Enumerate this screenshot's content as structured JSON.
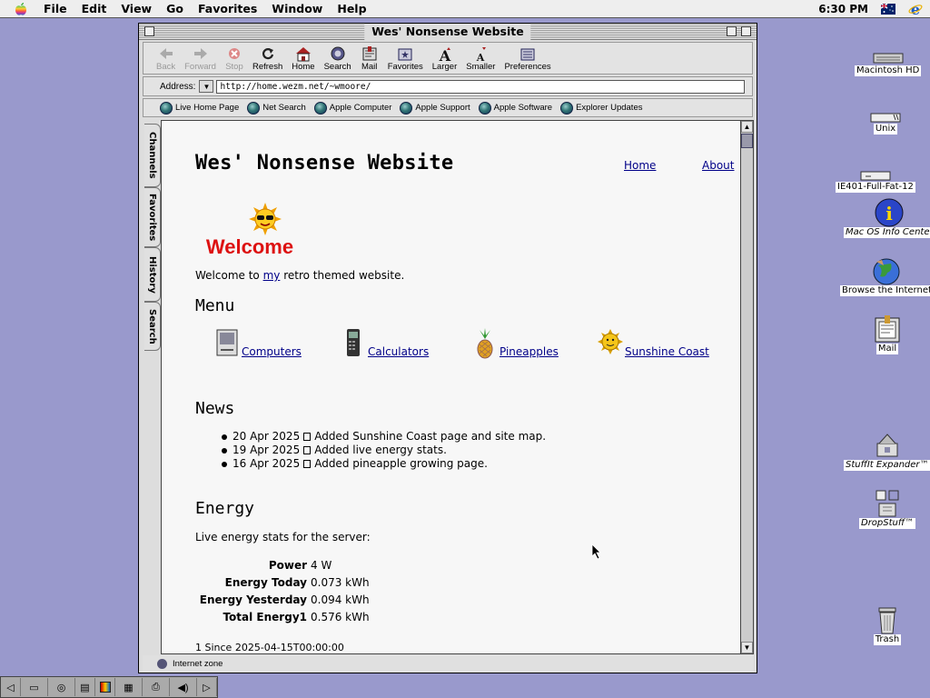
{
  "menubar": {
    "items": [
      "File",
      "Edit",
      "View",
      "Go",
      "Favorites",
      "Window",
      "Help"
    ],
    "clock": "6:30 PM"
  },
  "window": {
    "title": "Wes' Nonsense Website",
    "toolbar": [
      {
        "label": "Back",
        "icon": "back-arrow-icon",
        "enabled": false
      },
      {
        "label": "Forward",
        "icon": "forward-arrow-icon",
        "enabled": false
      },
      {
        "label": "Stop",
        "icon": "stop-icon",
        "enabled": false
      },
      {
        "label": "Refresh",
        "icon": "refresh-icon",
        "enabled": true
      },
      {
        "label": "Home",
        "icon": "home-icon",
        "enabled": true
      },
      {
        "label": "Search",
        "icon": "search-icon",
        "enabled": true
      },
      {
        "label": "Mail",
        "icon": "mail-icon",
        "enabled": true
      },
      {
        "label": "Favorites",
        "icon": "favorites-icon",
        "enabled": true
      },
      {
        "label": "Larger",
        "icon": "larger-font-icon",
        "enabled": true
      },
      {
        "label": "Smaller",
        "icon": "smaller-font-icon",
        "enabled": true
      },
      {
        "label": "Preferences",
        "icon": "preferences-icon",
        "enabled": true
      }
    ],
    "address_label": "Address:",
    "address_value": "http://home.wezm.net/~wmoore/",
    "links": [
      "Live Home Page",
      "Net Search",
      "Apple Computer",
      "Apple Support",
      "Apple Software",
      "Explorer Updates"
    ],
    "side_tabs": [
      "Channels",
      "Favorites",
      "History",
      "Search"
    ],
    "status": "Internet zone"
  },
  "page": {
    "site_title": "Wes' Nonsense Website",
    "nav": {
      "home": "Home",
      "about": "About"
    },
    "welcome_image_text": "Welcome",
    "welcome": {
      "before": "Welcome to ",
      "link": "my",
      "after": " retro themed website."
    },
    "menu_heading": "Menu",
    "menu_items": [
      {
        "label": "Computers",
        "icon": "computer-icon"
      },
      {
        "label": "Calculators",
        "icon": "calculator-icon"
      },
      {
        "label": "Pineapples",
        "icon": "pineapple-icon"
      },
      {
        "label": "Sunshine Coast",
        "icon": "sun-icon"
      }
    ],
    "news_heading": "News",
    "news": [
      {
        "date": "20 Apr 2025",
        "text": "Added Sunshine Coast page and site map."
      },
      {
        "date": "19 Apr 2025",
        "text": "Added live energy stats."
      },
      {
        "date": "16 Apr 2025",
        "text": "Added pineapple growing page."
      }
    ],
    "energy_heading": "Energy",
    "energy_intro": "Live energy stats for the server:",
    "energy": [
      {
        "key": "Power",
        "value": "4 W"
      },
      {
        "key": "Energy Today",
        "value": "0.073 kWh"
      },
      {
        "key": "Energy Yesterday",
        "value": "0.094 kWh"
      },
      {
        "key": "Total Energy1",
        "value": "0.576 kWh"
      }
    ],
    "footnote": "1 Since 2025-04-15T00:00:00"
  },
  "desktop_icons": [
    {
      "label": "Macintosh HD",
      "icon": "hard-disk-icon",
      "italic": false
    },
    {
      "label": "Unix",
      "icon": "disk-icon",
      "italic": false
    },
    {
      "label": "IE401-Full-Fat-12",
      "icon": "disk-icon",
      "italic": false
    },
    {
      "label": "Mac OS Info Center",
      "icon": "info-icon",
      "italic": true
    },
    {
      "label": "Browse the Internet",
      "icon": "globe-icon",
      "italic": false
    },
    {
      "label": "Mail",
      "icon": "mail-icon",
      "italic": false
    },
    {
      "label": "StuffIt Expander™",
      "icon": "stuffit-icon",
      "italic": true
    },
    {
      "label": "DropStuff™",
      "icon": "dropstuff-icon",
      "italic": true
    },
    {
      "label": "Trash",
      "icon": "trash-icon",
      "italic": false
    }
  ],
  "colors": {
    "desktop": "#9999cc",
    "link": "#000088"
  }
}
